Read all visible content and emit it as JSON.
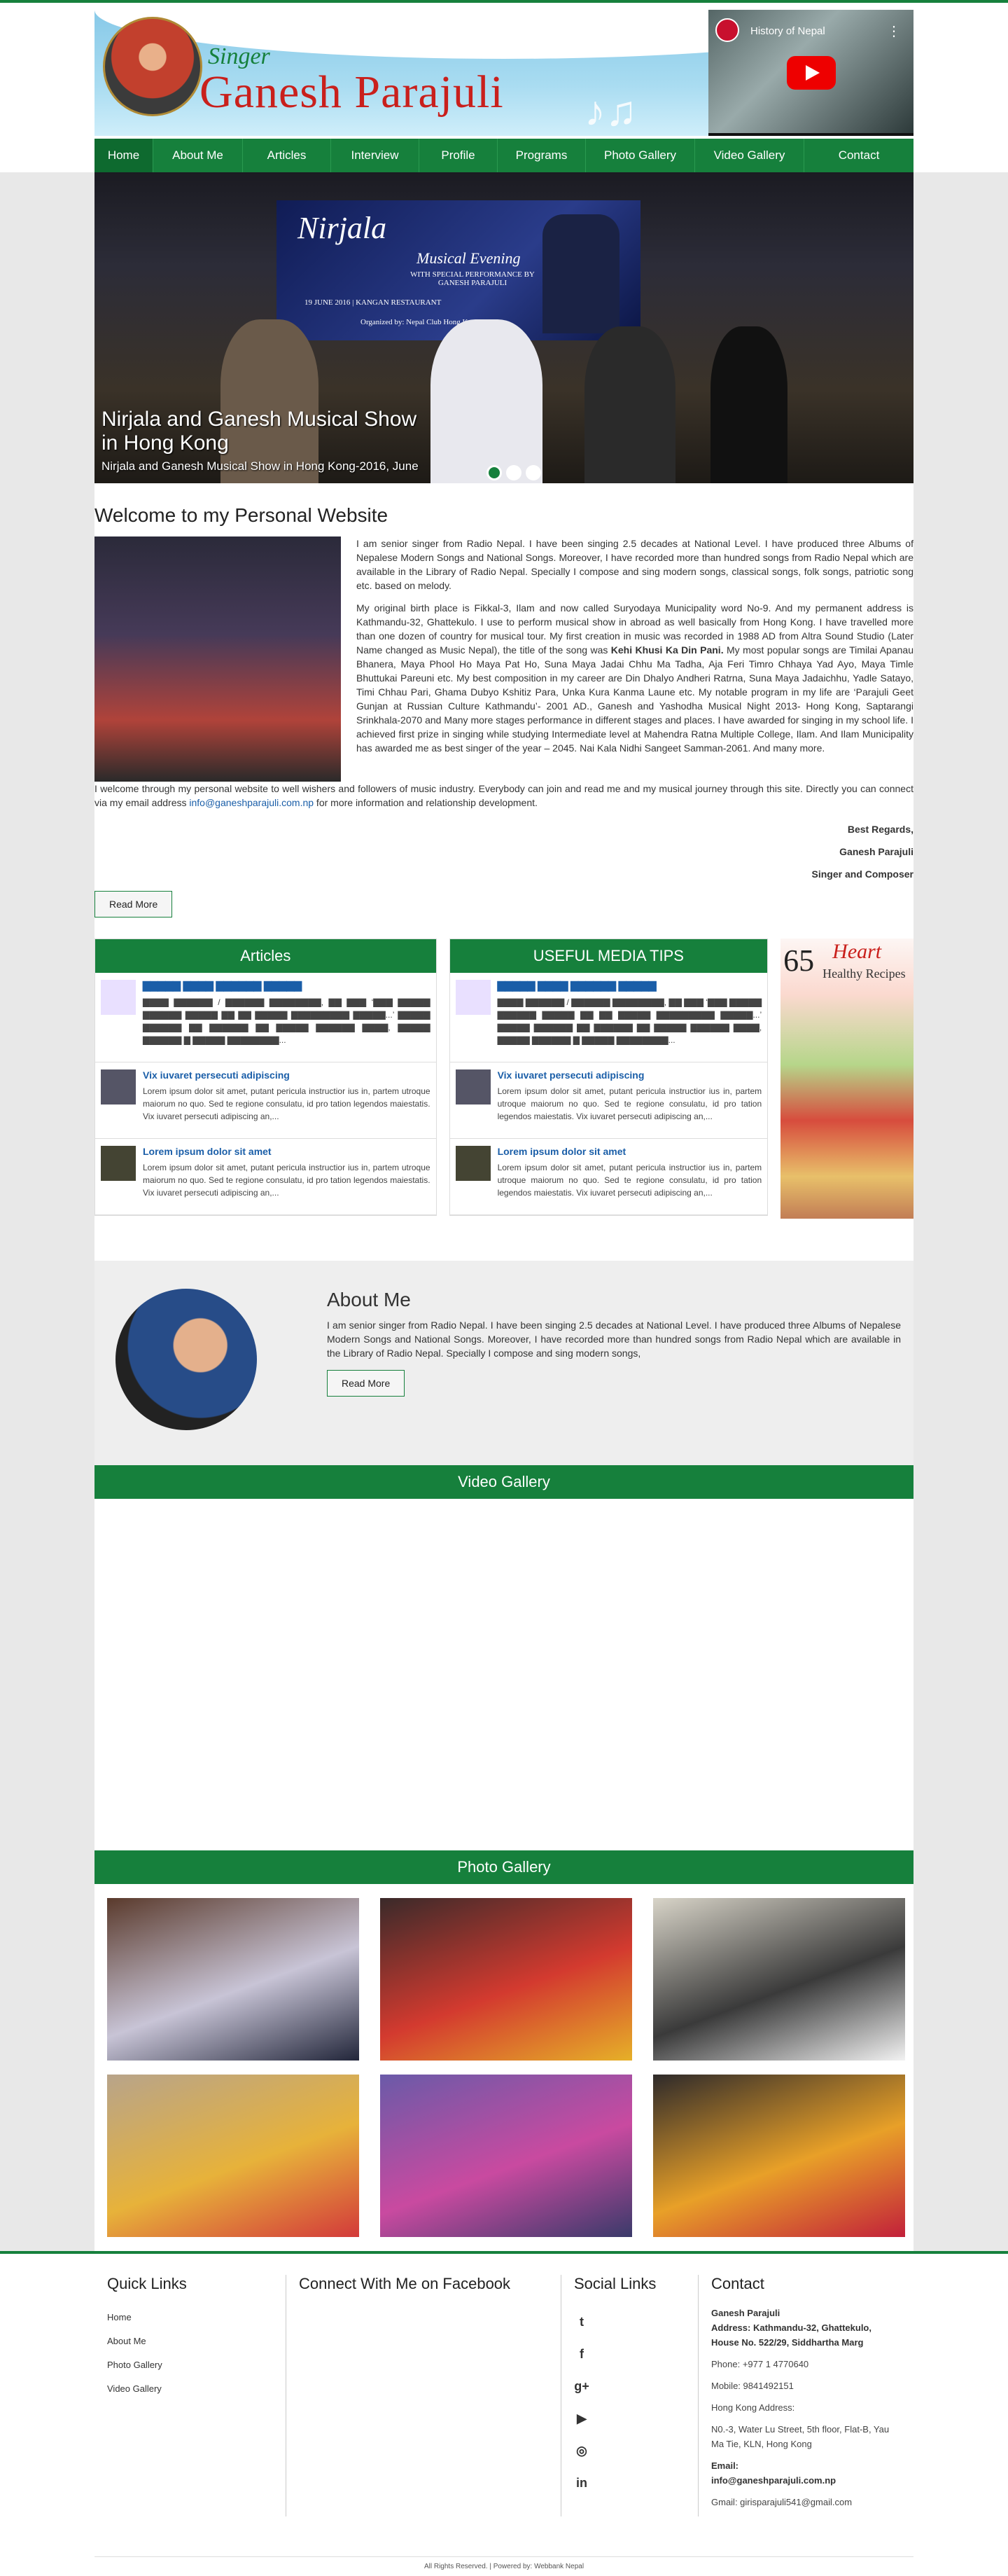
{
  "brand": {
    "kicker": "Singer",
    "name": "Ganesh Parajuli"
  },
  "video": {
    "title": "History of Nepal",
    "more": "⋮"
  },
  "nav": [
    "Home",
    "About Me",
    "Articles",
    "Interview",
    "Profile",
    "Programs",
    "Photo Gallery",
    "Video Gallery",
    "Contact"
  ],
  "slider": {
    "banner_title": "Nirjala",
    "banner_sub": "Musical Evening",
    "banner_line": "WITH SPECIAL PERFORMANCE BY GANESH PARAJULI",
    "banner_date": "19 JUNE 2016 | KANGAN RESTAURANT",
    "banner_org": "Organized by: Nepal Club Hong Kong",
    "caption_title": "Nirjala and Ganesh Musical Show in Hong Kong",
    "caption_sub": "Nirjala and Ganesh Musical Show in Hong Kong-2016, June"
  },
  "welcome": {
    "heading": "Welcome to my Personal Website",
    "p1": "I am senior singer from Radio Nepal. I have been singing 2.5 decades at National Level. I have produced three Albums of Nepalese Modern Songs and National Songs. Moreover, I have recorded more than hundred songs from Radio Nepal which are available in the Library of Radio Nepal.  Specially I compose and sing modern songs, classical songs, folk songs, patriotic song etc. based on melody.",
    "p2_a": "My original birth place is Fikkal-3, Ilam and now called Suryodaya Municipality word No-9. And my permanent address is  Kathmandu-32, Ghattekulo. I use to perform musical show in abroad as well basically from Hong Kong. I have travelled more than one dozen of country for musical tour.  My first creation in music was recorded in 1988 AD from Altra Sound Studio (Later Name changed as Music Nepal), the title of the song was ",
    "p2_bold": "Kehi Khusi Ka Din Pani.",
    "p2_b": " My most popular songs are Timilai Apanau Bhanera, Maya Phool Ho Maya Pat Ho,  Suna Maya Jadai Chhu Ma Tadha, Aja Feri Timro Chhaya Yad Ayo, Maya Timle Bhuttukai Pareuni etc.  My best composition in my career are Din Dhalyo Andheri Ratrna, Suna Maya Jadaichhu, Yadle Satayo, Timi Chhau Pari, Ghama Dubyo Kshitiz Para, Unka Kura Kanma Laune etc. My notable program in my life are ‘Parajuli Geet Gunjan at Russian Culture Kathmandu’- 2001 AD., Ganesh and Yashodha Musical Night 2013- Hong Kong, Saptarangi Srinkhala-2070 and Many more stages performance in different stages and places. I have awarded for singing in my school life. I achieved first prize in singing while studying Intermediate level at Mahendra Ratna Multiple College, Ilam. And Ilam Municipality has awarded me as best singer of the year – 2045.  Nai Kala Nidhi Sangeet Samman-2061. And many more.",
    "p3_a": "I welcome through my personal website to well wishers and followers of music industry. Everybody can join and read me and my musical journey through this site. Directly you can connect via my email address ",
    "p3_email": "info@ganeshparajuli.com.np",
    "p3_b": " for more information and relationship development.",
    "sign1": "Best Regards,",
    "sign2": "Ganesh Parajuli",
    "sign3": "Singer and  Composer",
    "read_more": "Read More"
  },
  "articles": {
    "heading": "Articles",
    "items": [
      {
        "title": "▇▇▇▇▇ ▇▇▇▇ ▇▇▇▇▇▇ ▇▇▇▇▇",
        "text": "▇▇▇▇ ▇▇▇▇▇▇ / ▇▇▇▇▇▇ ▇▇▇▇▇▇▇▇, ▇▇ ▇▇▇ ‘▇▇▇ ▇▇▇▇▇ ▇▇▇▇▇▇ ▇▇▇▇▇ ▇▇ ▇▇ ▇▇▇▇▇ ▇▇▇▇▇▇▇▇▇ ▇▇▇▇▇...’ ▇▇▇▇▇ ▇▇▇▇▇▇ ▇▇ ▇▇▇▇▇▇ ▇▇ ▇▇▇▇▇ ▇▇▇▇▇▇ ▇▇▇▇, ▇▇▇▇▇ ▇▇▇▇▇▇ ▇ ▇▇▇▇▇ ▇▇▇▇▇▇▇▇..."
      },
      {
        "title": "Vix iuvaret persecuti adipiscing",
        "text": "Lorem ipsum dolor sit amet, putant pericula instructior ius in, partem utroque maiorum no quo. Sed te regione consulatu, id pro tation legendos maiestatis. Vix iuvaret persecuti adipiscing an,..."
      },
      {
        "title": "Lorem ipsum dolor sit amet",
        "text": "Lorem ipsum dolor sit amet, putant pericula instructior ius in, partem utroque maiorum no quo. Sed te regione consulatu, id pro tation legendos maiestatis. Vix iuvaret persecuti adipiscing an,..."
      }
    ]
  },
  "tips": {
    "heading": "USEFUL MEDIA TIPS",
    "items": [
      {
        "title": "▇▇▇▇▇ ▇▇▇▇ ▇▇▇▇▇▇ ▇▇▇▇▇",
        "text": "▇▇▇▇ ▇▇▇▇▇▇ / ▇▇▇▇▇▇ ▇▇▇▇▇▇▇▇, ▇▇ ▇▇▇ ‘▇▇▇ ▇▇▇▇▇ ▇▇▇▇▇▇ ▇▇▇▇▇ ▇▇ ▇▇ ▇▇▇▇▇ ▇▇▇▇▇▇▇▇▇ ▇▇▇▇▇...’ ▇▇▇▇▇ ▇▇▇▇▇▇ ▇▇ ▇▇▇▇▇▇ ▇▇ ▇▇▇▇▇ ▇▇▇▇▇▇ ▇▇▇▇, ▇▇▇▇▇ ▇▇▇▇▇▇ ▇ ▇▇▇▇▇ ▇▇▇▇▇▇▇▇..."
      },
      {
        "title": "Vix iuvaret persecuti adipiscing",
        "text": "Lorem ipsum dolor sit amet, putant pericula instructior ius in, partem utroque maiorum no quo. Sed te regione consulatu, id pro tation legendos maiestatis. Vix iuvaret persecuti adipiscing an,..."
      },
      {
        "title": "Lorem ipsum dolor sit amet",
        "text": "Lorem ipsum dolor sit amet, putant pericula instructior ius in, partem utroque maiorum no quo. Sed te regione consulatu, id pro tation legendos maiestatis. Vix iuvaret persecuti adipiscing an,..."
      }
    ]
  },
  "poster": {
    "number": "65",
    "word": "Heart",
    "sub": "Healthy Recipes"
  },
  "about": {
    "heading": "About Me",
    "text": "I am senior singer from Radio Nepal. I have been singing 2.5 decades at National Level. I have produced three Albums of Nepalese Modern Songs and National Songs. Moreover, I have recorded more than hundred songs from Radio Nepal which are available in the Library of Radio Nepal.  Specially I compose and sing modern songs,",
    "button": "Read More"
  },
  "video_gallery": {
    "heading": "Video Gallery"
  },
  "photo_gallery": {
    "heading": "Photo Gallery",
    "photos": [
      {
        "c1": "#5a3a2c",
        "c2": "#c8c4d6",
        "c3": "#22263a"
      },
      {
        "c1": "#3a2a2a",
        "c2": "#d33a2f",
        "c3": "#e6b028"
      },
      {
        "c1": "#d8d4c8",
        "c2": "#3a3a3a",
        "c3": "#f2f2f2"
      },
      {
        "c1": "#b8a48a",
        "c2": "#e7b23a",
        "c3": "#d33a3a"
      },
      {
        "c1": "#6a5aa8",
        "c2": "#c94aa0",
        "c3": "#3a3a6a"
      },
      {
        "c1": "#2e2a2a",
        "c2": "#e8a028",
        "c3": "#c2203a"
      }
    ]
  },
  "footer": {
    "quick_heading": "Quick Links",
    "quick_links": [
      "Home",
      "About Me",
      "Photo Gallery",
      "Video Gallery"
    ],
    "facebook_heading": "Connect With Me on Facebook",
    "social_heading": "Social Links",
    "social": [
      {
        "icon": "twitter-icon",
        "glyph": "t"
      },
      {
        "icon": "facebook-icon",
        "glyph": "f"
      },
      {
        "icon": "google-plus-icon",
        "glyph": "g+"
      },
      {
        "icon": "youtube-icon",
        "glyph": "▶"
      },
      {
        "icon": "instagram-icon",
        "glyph": "◎"
      },
      {
        "icon": "linkedin-icon",
        "glyph": "in"
      }
    ],
    "contact_heading": "Contact",
    "contact_name": "Ganesh Parajuli",
    "contact_address": "Address: Kathmandu-32, Ghattekulo, House No. 522/29, Siddhartha Marg",
    "contact_phone": "Phone: +977  1 4770640",
    "contact_mobile": "Mobile: 9841492151",
    "contact_hk_label": "Hong Kong Address:",
    "contact_hk": "N0.-3, Water Lu Street, 5th floor, Flat-B, Yau Ma Tie, KLN, Hong Kong",
    "contact_email_label": "Email:",
    "contact_email": "info@ganeshparajuli.com.np",
    "contact_gmail": "Gmail: girisparajuli541@gmail.com",
    "copyright": "All Rights Reserved. | Powered by: Webbank Nepal"
  },
  "colors": {
    "brand_green": "#16803c",
    "brand_red": "#c9201c",
    "link_blue": "#1a5ea8"
  }
}
